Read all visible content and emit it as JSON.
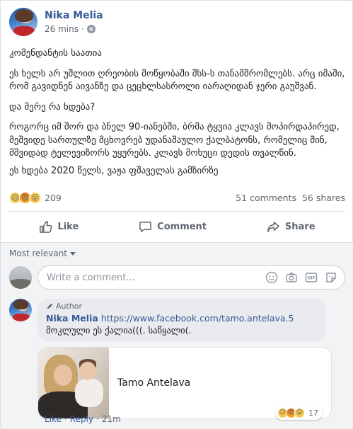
{
  "post": {
    "author": "Nika Melia",
    "time": "26 mins",
    "privacy_icon": "globe-icon",
    "paragraphs": [
      "კომენდანტის საათია",
      "ეს ხელს არ უშლით ღრეობის მოწყობაში შსს-ს თანამშრომლებს. არც იმაში, რომ გავიდნენ აივანზე და ცეცხლსასროლი იარაღიდან ჯერი გაუშვან.",
      "და მერე რა ხდება?",
      "როგორც იმ შორ და ბნელ 90-იანებში, ბრმა ტყვია კლავს მოპირდაპირედ, მეშვიდე სართულზე მცხოვრებ უდანაშაულო ქალბატონს, რომელიც შინ, მშვიდად ტელევიზორს უყურებს. კლავს მოხუცი დედის თვალწინ.",
      "ეს ხდება 2020 წელს, ვაჟა ფშაველას გამზირზე"
    ]
  },
  "stats": {
    "reactions": [
      "sad",
      "angry",
      "wow"
    ],
    "reaction_count": "209",
    "comments": "51 comments",
    "shares": "56 shares"
  },
  "actions": {
    "like": "Like",
    "comment": "Comment",
    "share": "Share"
  },
  "comments_section": {
    "sort_label": "Most relevant",
    "input_placeholder": "Write a comment...",
    "input_icons": [
      "emoji-icon",
      "camera-icon",
      "gif-icon",
      "sticker-icon"
    ]
  },
  "comment": {
    "author_tag": "Author",
    "author": "Nika Melia",
    "link": "https://www.facebook.com/tamo.antelava.5",
    "text": " მოკლული ეს ქალია(((. საწყალი(.",
    "link_preview_title": "Tamo Antelava",
    "reaction_count": "17",
    "like": "Like",
    "reply": "Reply",
    "separator": "·",
    "time": "21m"
  }
}
